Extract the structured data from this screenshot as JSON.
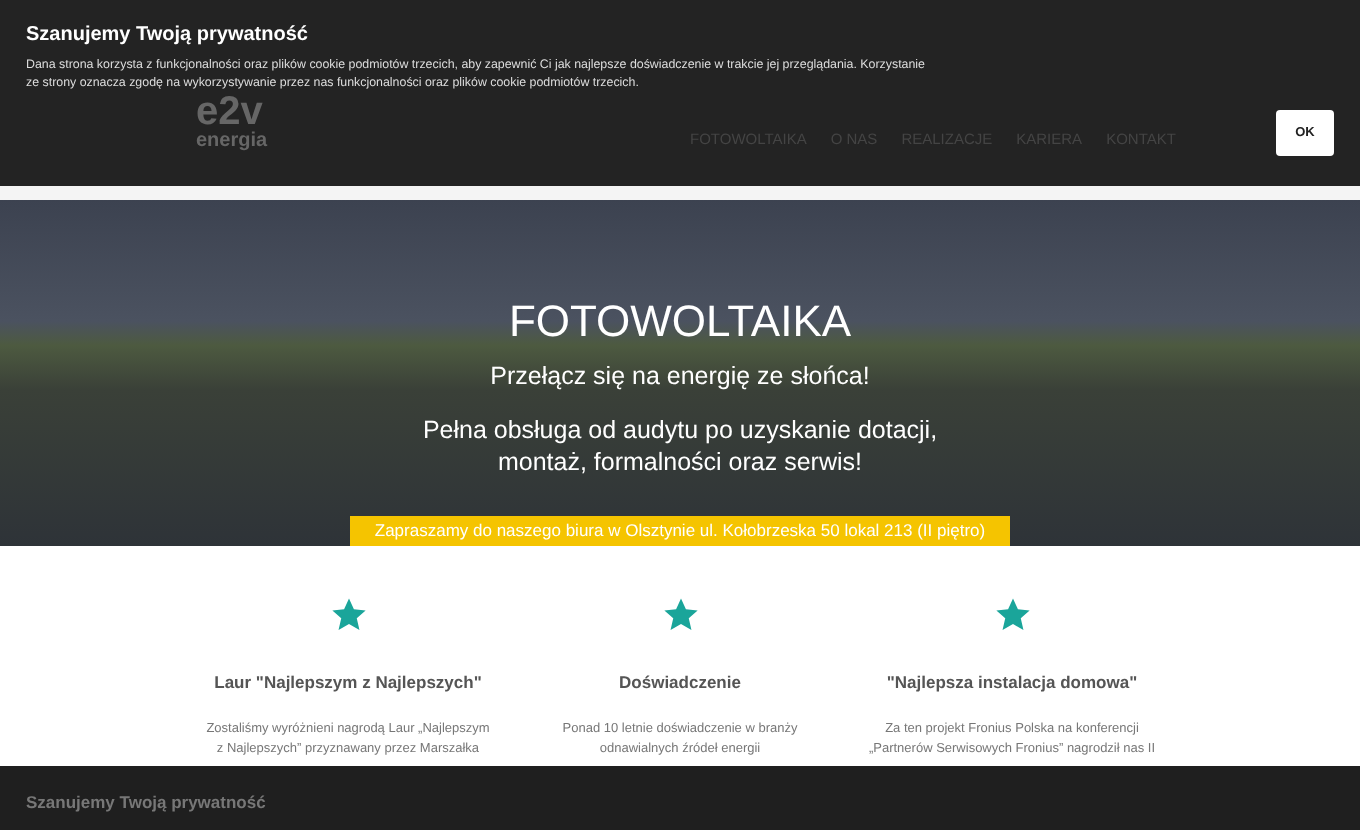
{
  "cookie_banner": {
    "title": "Szanujemy Twoją prywatność",
    "text": "Dana strona korzysta z funkcjonalności oraz plików cookie podmiotów trzecich, aby zapewnić Ci jak najlepsze doświadczenie w trakcie jej przeglądania. Korzystanie ze strony oznacza zgodę na wykorzystywanie przez nas funkcjonalności oraz plików cookie podmiotów trzecich.",
    "button": "OK"
  },
  "header": {
    "logo": "e2v",
    "logo_sub": "energia",
    "nav": [
      {
        "label": "FOTOWOLTAIKA",
        "selected": false
      },
      {
        "label": "O NAS",
        "selected": false
      },
      {
        "label": "REALIZACJE",
        "selected": false
      },
      {
        "label": "KARIERA",
        "selected": false
      },
      {
        "label": "KONTAKT",
        "selected": false
      }
    ]
  },
  "hero": {
    "title": "FOTOWOLTAIKA",
    "subtitle": "Przełącz się na energię ze słońca!",
    "text": "Pełna obsługa od audytu po uzyskanie dotacji, montaż, formalności oraz serwis!",
    "notice": "Zapraszamy do naszego biura w Olsztynie ul. Kołobrzeska 50 lokal 213 (II piętro)"
  },
  "features": [
    {
      "title": "Laur \"Najlepszym z Najlepszych\"",
      "text": "Zostaliśmy wyróżnieni nagrodą Laur „Najlepszym z Najlepszych” przyznawany przez Marszałka"
    },
    {
      "title": "Doświadczenie",
      "text": "Ponad 10 letnie doświadczenie w branży odnawialnych źródeł energii"
    },
    {
      "title": "\"Najlepsza instalacja domowa\"",
      "text": "Za ten projekt Fronius Polska na konferencji „Partnerów Serwisowych Fronius” nagrodził nas II"
    }
  ],
  "bottom_banner": {
    "title": "Szanujemy Twoją prywatność"
  }
}
